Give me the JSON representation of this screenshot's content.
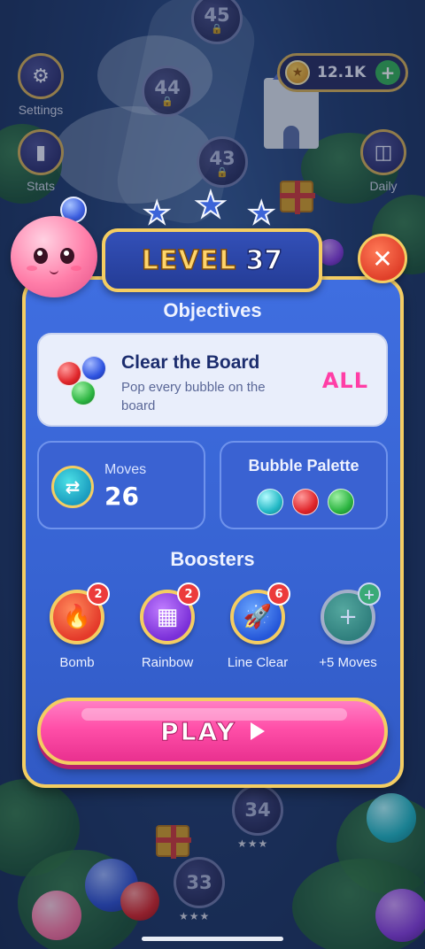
{
  "hud": {
    "coins": "12.1K",
    "settings_label": "Settings",
    "stats_label": "Stats",
    "daily_label": "Daily"
  },
  "map": {
    "nodes": [
      "45",
      "44",
      "43",
      "34",
      "33"
    ]
  },
  "level": {
    "word": "LEVEL",
    "number": "37"
  },
  "objectives": {
    "title": "Objectives",
    "card": {
      "title": "Clear the Board",
      "description": "Pop every bubble on the board",
      "target": "ALL"
    }
  },
  "moves": {
    "label": "Moves",
    "value": "26"
  },
  "palette": {
    "label": "Bubble Palette",
    "colors": [
      "teal",
      "red",
      "green"
    ]
  },
  "boosters": {
    "title": "Boosters",
    "items": [
      {
        "label": "Bomb",
        "count": "2",
        "icon": "flame-icon"
      },
      {
        "label": "Rainbow",
        "count": "2",
        "icon": "rainbow-grid-icon"
      },
      {
        "label": "Line Clear",
        "count": "6",
        "icon": "rocket-icon"
      },
      {
        "label": "+5 Moves",
        "count": "+",
        "icon": "plus-icon"
      }
    ]
  },
  "play": {
    "label": "PLAY"
  },
  "colors": {
    "gold_border": "#f4cd62",
    "panel_blue": "#3763d2",
    "play_pink": "#ff4fa8",
    "target_pink": "#ff3ea6"
  }
}
